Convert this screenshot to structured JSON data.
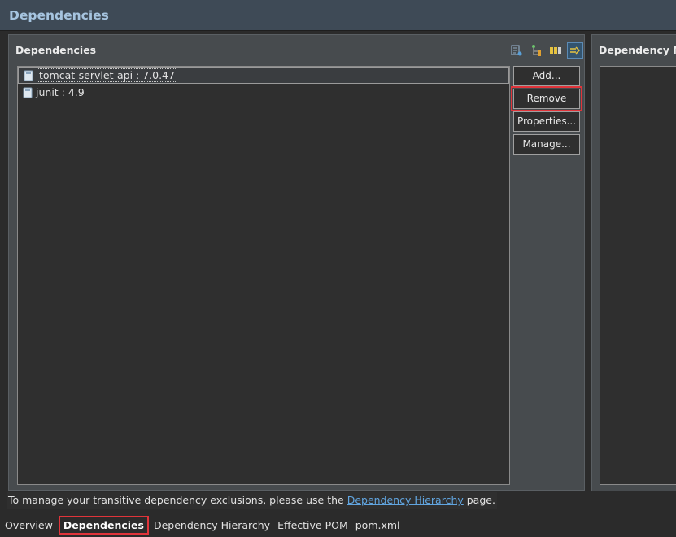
{
  "header": {
    "title": "Dependencies"
  },
  "dependencies_section": {
    "title": "Dependencies",
    "toolbar_icons": [
      "filter-icon",
      "tree-icon",
      "columns-icon",
      "link-icon"
    ],
    "items": [
      {
        "label": "tomcat-servlet-api : 7.0.47",
        "icon": "jar-icon",
        "selected": true
      },
      {
        "label": "junit : 4.9",
        "icon": "jar-icon",
        "selected": false
      }
    ],
    "buttons": {
      "add": "Add...",
      "remove": "Remove",
      "properties": "Properties...",
      "manage": "Manage..."
    }
  },
  "managed_section": {
    "title": "Dependency Ma"
  },
  "info_bar": {
    "prefix": "To manage your transitive dependency exclusions, please use the ",
    "link": "Dependency Hierarchy",
    "suffix": " page."
  },
  "tabs": [
    {
      "label": "Overview",
      "active": false
    },
    {
      "label": "Dependencies",
      "active": true
    },
    {
      "label": "Dependency Hierarchy",
      "active": false
    },
    {
      "label": "Effective POM",
      "active": false
    },
    {
      "label": "pom.xml",
      "active": false
    }
  ],
  "colors": {
    "header_title": "#a6c4df",
    "link": "#61a5e0",
    "highlight": "#e0343a"
  }
}
